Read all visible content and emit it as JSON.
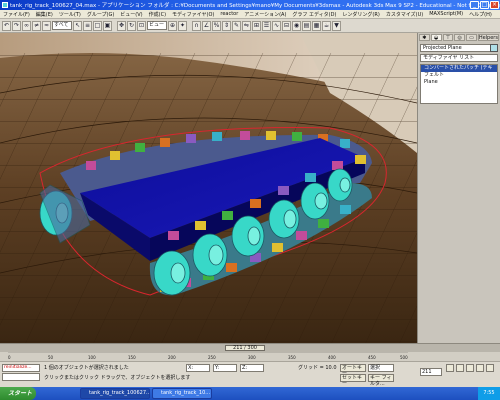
{
  "window": {
    "title": "tank_rig_track_100627_04.max - アプリケーション フォルダ : C:¥Documents and Settings¥mano¥My Documents¥3dsmax - Autodesk 3ds Max 9 SP2 - Educational - Not for Commer..."
  },
  "menu": [
    "ファイル(F)",
    "編集(E)",
    "ツール(T)",
    "グループ(G)",
    "ビュー(V)",
    "作成(C)",
    "モディファイヤ(O)",
    "reactor",
    "アニメーション(A)",
    "グラフ エディタ(D)",
    "レンダリング(R)",
    "カスタマイズ(U)",
    "MAXScript(M)",
    "ヘルプ(H)"
  ],
  "toolbar": {
    "select_filter": "すべて",
    "view_dropdown": "ビュー"
  },
  "command_panel": {
    "tabs": [
      "Helpers"
    ],
    "object_name": "Projected Plane",
    "modifier_list": "モディファイヤ リスト",
    "stack": [
      "コンバートされたパッチ (テキスト)",
      "フェルト",
      "Plane"
    ]
  },
  "timeline": {
    "frame_label": "211 / 300",
    "ruler_ticks": [
      "0",
      "50",
      "100",
      "150",
      "200",
      "250",
      "300",
      "350",
      "400",
      "450",
      "500"
    ]
  },
  "status": {
    "maxscript_text": "reinitialize...",
    "status_line": "1 個のオブジェクトが選択されました",
    "prompt_line": "クリックまたはクリック ドラッグで、オブジェクトを選択します",
    "coord_x": "X:",
    "coord_y": "Y:",
    "coord_z": "Z:",
    "grid": "グリッド = 10.0",
    "auto_key": "オートキー",
    "key_filter": "選択",
    "set_key": "セットキー",
    "key_filters": "キー フィルタ...",
    "frame_field": "211"
  },
  "taskbar": {
    "start_label": "スタート",
    "items": [
      "tank_rig_track_100627...",
      "tank_rig_track_10..."
    ],
    "clock": "7:55"
  }
}
